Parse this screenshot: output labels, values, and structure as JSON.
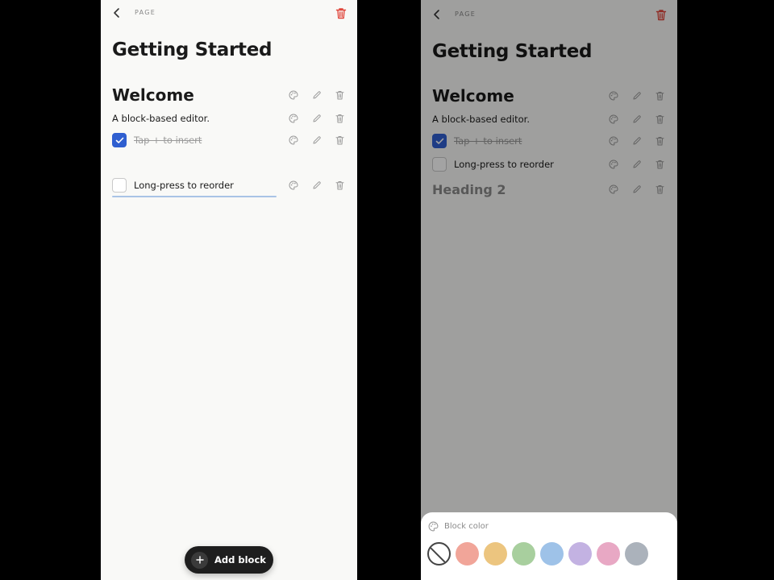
{
  "left": {
    "header": {
      "page_label": "PAGE"
    },
    "page_title": "Getting Started",
    "blocks": [
      {
        "type": "heading1",
        "text": "Welcome"
      },
      {
        "type": "paragraph",
        "text": "A block-based editor."
      },
      {
        "type": "todo",
        "checked": true,
        "text": "Tap + to insert"
      },
      {
        "type": "todo",
        "checked": false,
        "text": "Long-press to reorder"
      }
    ],
    "fab": {
      "label": "Add block"
    }
  },
  "right": {
    "header": {
      "page_label": "PAGE"
    },
    "page_title": "Getting Started",
    "blocks": [
      {
        "type": "heading1",
        "text": "Welcome"
      },
      {
        "type": "paragraph",
        "text": "A block-based editor."
      },
      {
        "type": "todo",
        "checked": true,
        "text": "Tap + to insert"
      },
      {
        "type": "todo",
        "checked": false,
        "text": "Long-press to reorder"
      },
      {
        "type": "heading2",
        "text": "Heading 2"
      }
    ],
    "sheet": {
      "title": "Block color",
      "swatches": [
        {
          "name": "none",
          "color": "none"
        },
        {
          "name": "red",
          "color": "#f1a599"
        },
        {
          "name": "yellow",
          "color": "#ecc57f"
        },
        {
          "name": "green",
          "color": "#a8cf9e"
        },
        {
          "name": "blue",
          "color": "#9ec2e8"
        },
        {
          "name": "purple",
          "color": "#c3b2e2"
        },
        {
          "name": "pink",
          "color": "#e8a8c4"
        },
        {
          "name": "gray",
          "color": "#abb2bb"
        }
      ]
    }
  },
  "colors": {
    "accent": "#2f5fd0",
    "danger": "#e0453a",
    "icon": "#9a9a9a"
  },
  "icons": {
    "back": "chevron-left-icon",
    "delete_page": "trash-icon",
    "block_color": "palette-icon",
    "block_edit": "pencil-icon",
    "block_delete": "trash-icon",
    "add": "plus-icon"
  }
}
